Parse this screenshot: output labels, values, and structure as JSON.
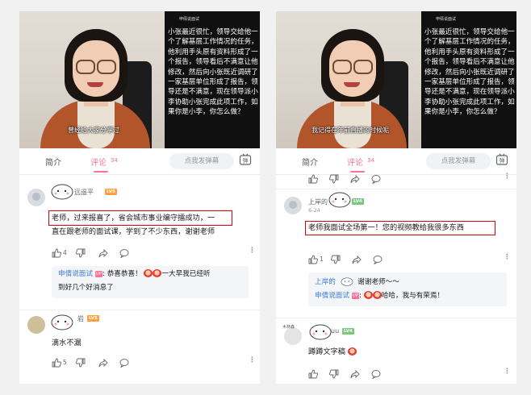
{
  "left": {
    "video": {
      "watermark": "申倩说面试",
      "text": "小张最近很忙，领导交给他一个了解基层工作情况的任务，他利用手头原有资料形成了一个报告，领导看后不满意让他修改，然后向小张既近调研了一家基层单位形成了报告，领导还是不满意，现在领导派小李协助小张完成此项工作，如果你是小李，你怎么做？",
      "subtitle": "曾经给大家分享过"
    },
    "tabs": {
      "intro": "简介",
      "comments": "评论",
      "count": "34"
    },
    "danmu_placeholder": "点我发弹幕",
    "danmu_icon_text": "弹",
    "comment1": {
      "username": "远遥平",
      "level": "LV5",
      "line1_highlighted": "老师，过来报喜了，省会城市事业编守擂成功，",
      "line1_rest": "一",
      "line2": "直在跟老师的面试课，学到了不少东西，谢谢老师",
      "likes": "4",
      "reply": {
        "name": "申倩说面试",
        "badge": "UP",
        "line1_a": ": 恭喜恭喜！",
        "line1_b": "一大早我已经听",
        "line2": "到好几个好消息了"
      }
    },
    "comment2": {
      "username": "岩",
      "level": "LV5",
      "text": "滴水不漏",
      "likes": "5"
    }
  },
  "right": {
    "video": {
      "watermark": "申倩说面试",
      "text": "小张最近很忙，领导交给他一个了解基层工作情况的任务，他利用手头原有资料形成了一个报告，领导看后不满意让他修改，然后向小张既近调研了一家基层单位形成了报告，领导还是不满意，现在领导派小李协助小张完成此项工作，如果你是小李，你怎么做？",
      "subtitle": "我记得在年前直播的时候呢"
    },
    "tabs": {
      "intro": "简介",
      "comments": "评论",
      "count": "34"
    },
    "danmu_placeholder": "点我发弹幕",
    "danmu_icon_text": "弹",
    "comment1": {
      "username": "上岸的",
      "level": "LV4",
      "date": "6-24",
      "highlighted": "老师我面试全场第一！您的视频教给我很多东西",
      "likes": "1",
      "reply1": {
        "name": "上岸的",
        "text": "谢谢老师～～"
      },
      "reply2": {
        "name": "申倩说面试",
        "badge": "UP",
        "text_a": ":",
        "text_b": "哈哈，我与有荣焉！"
      }
    },
    "comment2": {
      "name_prefix": "木林森",
      "username": "uu",
      "level": "LV4",
      "text": "蹲蹲文字稿"
    }
  }
}
